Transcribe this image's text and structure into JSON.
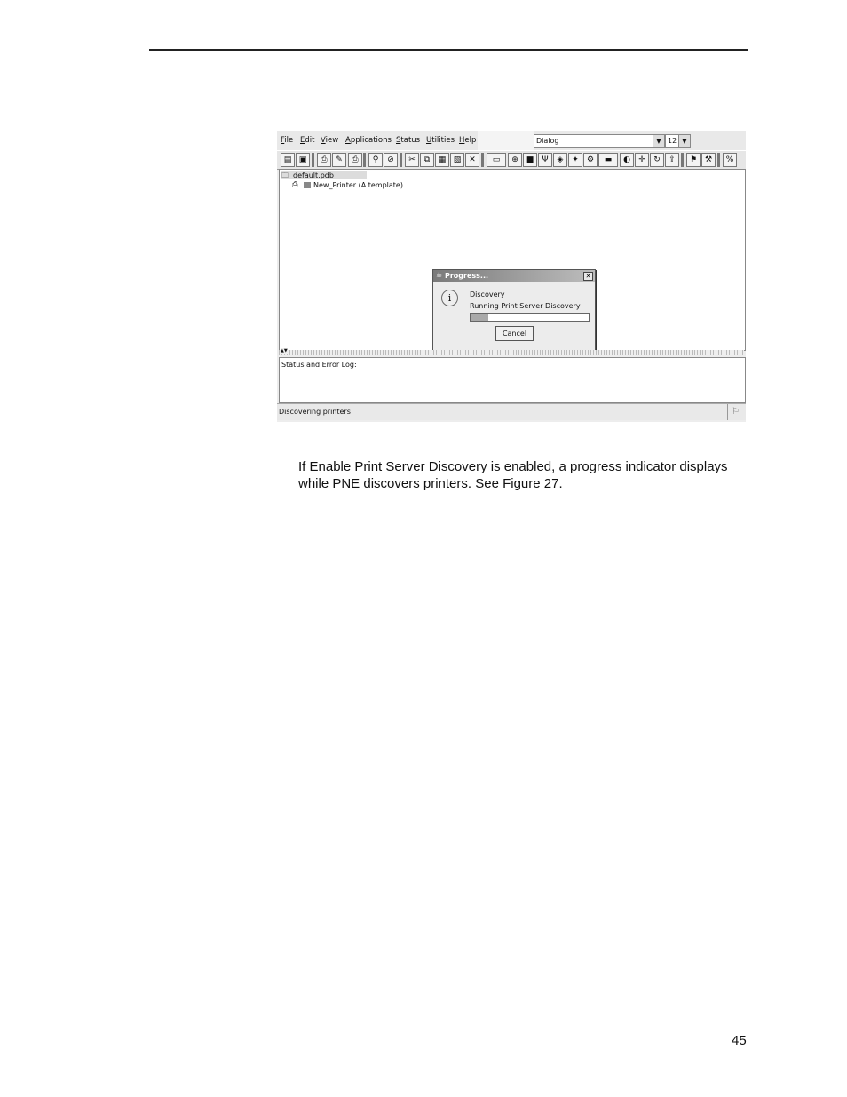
{
  "app": {
    "menus": [
      "File",
      "Edit",
      "View",
      "Applications",
      "Status",
      "Utilities",
      "Help"
    ],
    "font_name": "Dialog",
    "font_size": "12",
    "toolbar_icons": [
      "open-icon",
      "save-icon",
      "printer-add-icon",
      "printer-edit-icon",
      "printer-find-icon",
      "search-icon",
      "stop-icon",
      "cut-icon",
      "copy-icon",
      "paste-icon",
      "paste-special-icon",
      "delete-icon",
      "keyboard-icon",
      "network-icon",
      "lock-icon",
      "antenna-icon",
      "config-icon",
      "settings-icon",
      "tape-icon",
      "screen-icon",
      "expand-icon",
      "refresh-icon",
      "upgrade-icon",
      "flag-icon",
      "pin-icon",
      "percent-icon"
    ],
    "tree": {
      "root_label": "default.pdb",
      "child_label": "New_Printer (A template)"
    },
    "dialog": {
      "title": "Progress...",
      "heading": "Discovery",
      "message": "Running Print Server Discovery",
      "progress": 0.15,
      "cancel_label": "Cancel"
    },
    "log_label": "Status and Error Log:",
    "status_text": "Discovering printers"
  },
  "caption": {
    "line1": "If Enable Print Server Discovery is enabled, a progress indicator displays",
    "line2": "while PNE discovers printers. See Figure 27."
  },
  "page_number": "45"
}
